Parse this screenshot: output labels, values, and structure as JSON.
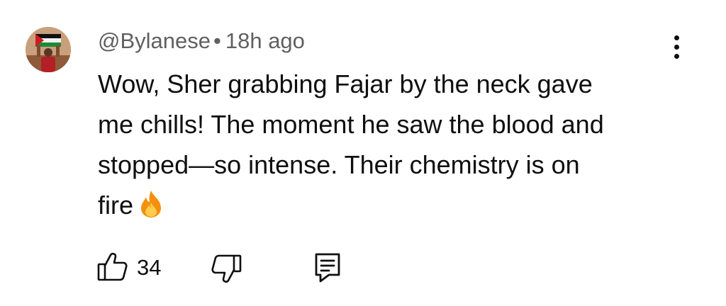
{
  "comment": {
    "author": "@Bylanese",
    "separator": "•",
    "time": "18h ago",
    "text_lines": [
      "Wow, Sher grabbing Fajar by the neck gave",
      "me chills! The moment he saw the blood and",
      "stopped—so intense. Their chemistry is on",
      "fire"
    ],
    "emoji": "fire-icon",
    "like_count": "34"
  },
  "icons": {
    "avatar": "avatar",
    "more": "more-vertical-icon",
    "like": "thumbs-up-icon",
    "dislike": "thumbs-down-icon",
    "reply": "reply-comment-icon"
  },
  "colors": {
    "text": "#0f0f0f",
    "meta": "#606060",
    "fire_outer": "#f4900c",
    "fire_inner": "#ffcc4d"
  }
}
